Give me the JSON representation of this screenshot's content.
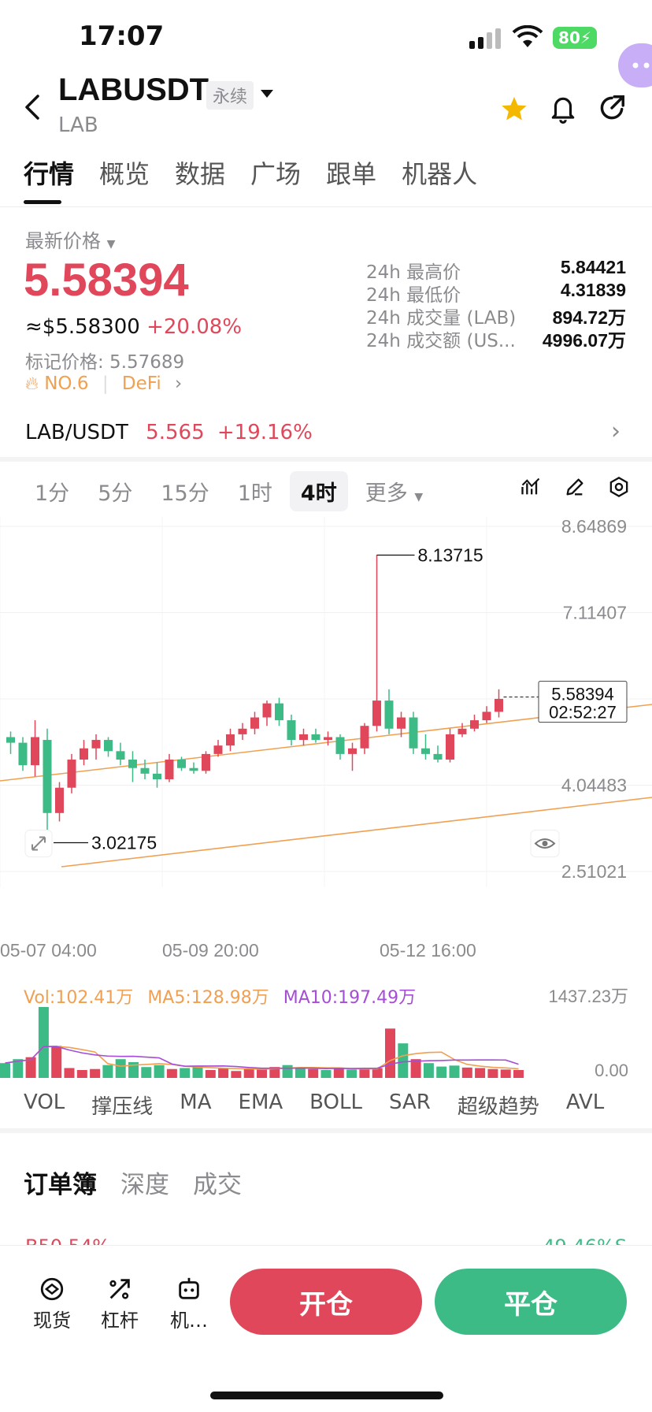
{
  "status": {
    "time": "17:07",
    "battery": "80"
  },
  "header": {
    "symbol": "LABUSDT",
    "contract_type": "永续",
    "base": "LAB"
  },
  "tabs": [
    {
      "label": "行情",
      "active": true
    },
    {
      "label": "概览",
      "active": false
    },
    {
      "label": "数据",
      "active": false
    },
    {
      "label": "广场",
      "active": false
    },
    {
      "label": "跟单",
      "active": false
    },
    {
      "label": "机器人",
      "active": false
    }
  ],
  "price": {
    "latest_label": "最新价格",
    "last": "5.58394",
    "usd": "≈$5.58300",
    "change": "+20.08%",
    "mark": "标记价格: 5.57689",
    "rank": "NO.6",
    "sector": "DeFi"
  },
  "stats": [
    {
      "label": "24h 最高价",
      "value": "5.84421"
    },
    {
      "label": "24h 最低价",
      "value": "4.31839"
    },
    {
      "label": "24h 成交量 (LAB)",
      "value": "894.72万"
    },
    {
      "label": "24h 成交额 (US...",
      "value": "4996.07万"
    }
  ],
  "spot": {
    "pair": "LAB/USDT",
    "price": "5.565",
    "change": "+19.16%"
  },
  "intervals": [
    {
      "label": "1分",
      "active": false
    },
    {
      "label": "5分",
      "active": false
    },
    {
      "label": "15分",
      "active": false
    },
    {
      "label": "1时",
      "active": false
    },
    {
      "label": "4时",
      "active": true
    }
  ],
  "more_label": "更多",
  "chart_data": {
    "type": "candlestick",
    "y_ticks": [
      "8.64869",
      "7.11407",
      "4.04483",
      "2.51021"
    ],
    "x_ticks": [
      "05-07 04:00",
      "05-09 20:00",
      "05-12 16:00"
    ],
    "ylim": [
      2.51021,
      8.64869
    ],
    "high_marker": "8.13715",
    "low_marker": "3.02175",
    "last_price_tag": "5.58394",
    "countdown": "02:52:27",
    "candles": [
      [
        4.9,
        5.0,
        4.6,
        4.8
      ],
      [
        4.8,
        4.9,
        4.3,
        4.4
      ],
      [
        4.4,
        5.2,
        4.2,
        4.9
      ],
      [
        4.85,
        5.05,
        3.0,
        3.55
      ],
      [
        3.55,
        4.1,
        3.4,
        4.0
      ],
      [
        4.0,
        4.6,
        3.9,
        4.5
      ],
      [
        4.5,
        4.85,
        4.4,
        4.7
      ],
      [
        4.7,
        4.95,
        4.5,
        4.85
      ],
      [
        4.85,
        4.9,
        4.55,
        4.65
      ],
      [
        4.65,
        4.8,
        4.4,
        4.5
      ],
      [
        4.5,
        4.65,
        4.1,
        4.35
      ],
      [
        4.35,
        4.5,
        4.15,
        4.25
      ],
      [
        4.25,
        4.45,
        4.0,
        4.15
      ],
      [
        4.15,
        4.6,
        4.1,
        4.5
      ],
      [
        4.5,
        4.55,
        4.3,
        4.35
      ],
      [
        4.35,
        4.45,
        4.25,
        4.3
      ],
      [
        4.3,
        4.65,
        4.25,
        4.6
      ],
      [
        4.6,
        4.85,
        4.55,
        4.75
      ],
      [
        4.75,
        5.05,
        4.65,
        4.95
      ],
      [
        4.95,
        5.15,
        4.85,
        5.05
      ],
      [
        5.05,
        5.35,
        4.95,
        5.25
      ],
      [
        5.25,
        5.55,
        5.1,
        5.5
      ],
      [
        5.5,
        5.6,
        5.1,
        5.2
      ],
      [
        5.2,
        5.3,
        4.75,
        4.85
      ],
      [
        4.85,
        5.05,
        4.75,
        4.95
      ],
      [
        4.95,
        5.05,
        4.8,
        4.85
      ],
      [
        4.85,
        5.0,
        4.75,
        4.9
      ],
      [
        4.9,
        4.95,
        4.5,
        4.6
      ],
      [
        4.6,
        4.8,
        4.3,
        4.7
      ],
      [
        4.7,
        5.15,
        4.6,
        5.1
      ],
      [
        5.1,
        8.14,
        5.0,
        5.55
      ],
      [
        5.55,
        5.75,
        4.95,
        5.05
      ],
      [
        5.05,
        5.35,
        4.9,
        5.25
      ],
      [
        5.25,
        5.35,
        4.6,
        4.7
      ],
      [
        4.7,
        4.95,
        4.5,
        4.6
      ],
      [
        4.6,
        4.75,
        4.45,
        4.5
      ],
      [
        4.5,
        5.05,
        4.45,
        4.95
      ],
      [
        4.95,
        5.15,
        4.9,
        5.05
      ],
      [
        5.05,
        5.3,
        5.0,
        5.2
      ],
      [
        5.2,
        5.45,
        5.15,
        5.35
      ],
      [
        5.35,
        5.75,
        5.25,
        5.58
      ]
    ],
    "volume_max_label": "1437.23万",
    "volume_zero_label": "0.00",
    "volume": [
      300,
      380,
      420,
      1437,
      650,
      200,
      160,
      180,
      260,
      380,
      320,
      220,
      260,
      180,
      200,
      240,
      160,
      200,
      140,
      180,
      190,
      220,
      260,
      200,
      180,
      160,
      210,
      170,
      180,
      200,
      1000,
      700,
      380,
      300,
      230,
      250,
      210,
      200,
      180,
      170,
      160
    ]
  },
  "volume_legend": {
    "vol": "Vol:102.41万",
    "ma5": "MA5:128.98万",
    "ma10": "MA10:197.49万"
  },
  "colors": {
    "up": "#e0475a",
    "down": "#3dbb86",
    "channel": "#f0a050",
    "ma5": "#f0a050",
    "ma10": "#a64dd6"
  },
  "indicator_tabs": [
    "VOL",
    "撑压线",
    "MA",
    "EMA",
    "BOLL",
    "SAR",
    "超级趋势",
    "AVL"
  ],
  "book_tabs": [
    {
      "label": "订单簿",
      "active": true
    },
    {
      "label": "深度",
      "active": false
    },
    {
      "label": "成交",
      "active": false
    }
  ],
  "book_peek": {
    "left": "B50.54%",
    "right": "49.46%S"
  },
  "bottom": {
    "spot_label": "现货",
    "leverage_label": "杠杆",
    "bot_label": "机…",
    "open_label": "开仓",
    "close_label": "平仓"
  }
}
